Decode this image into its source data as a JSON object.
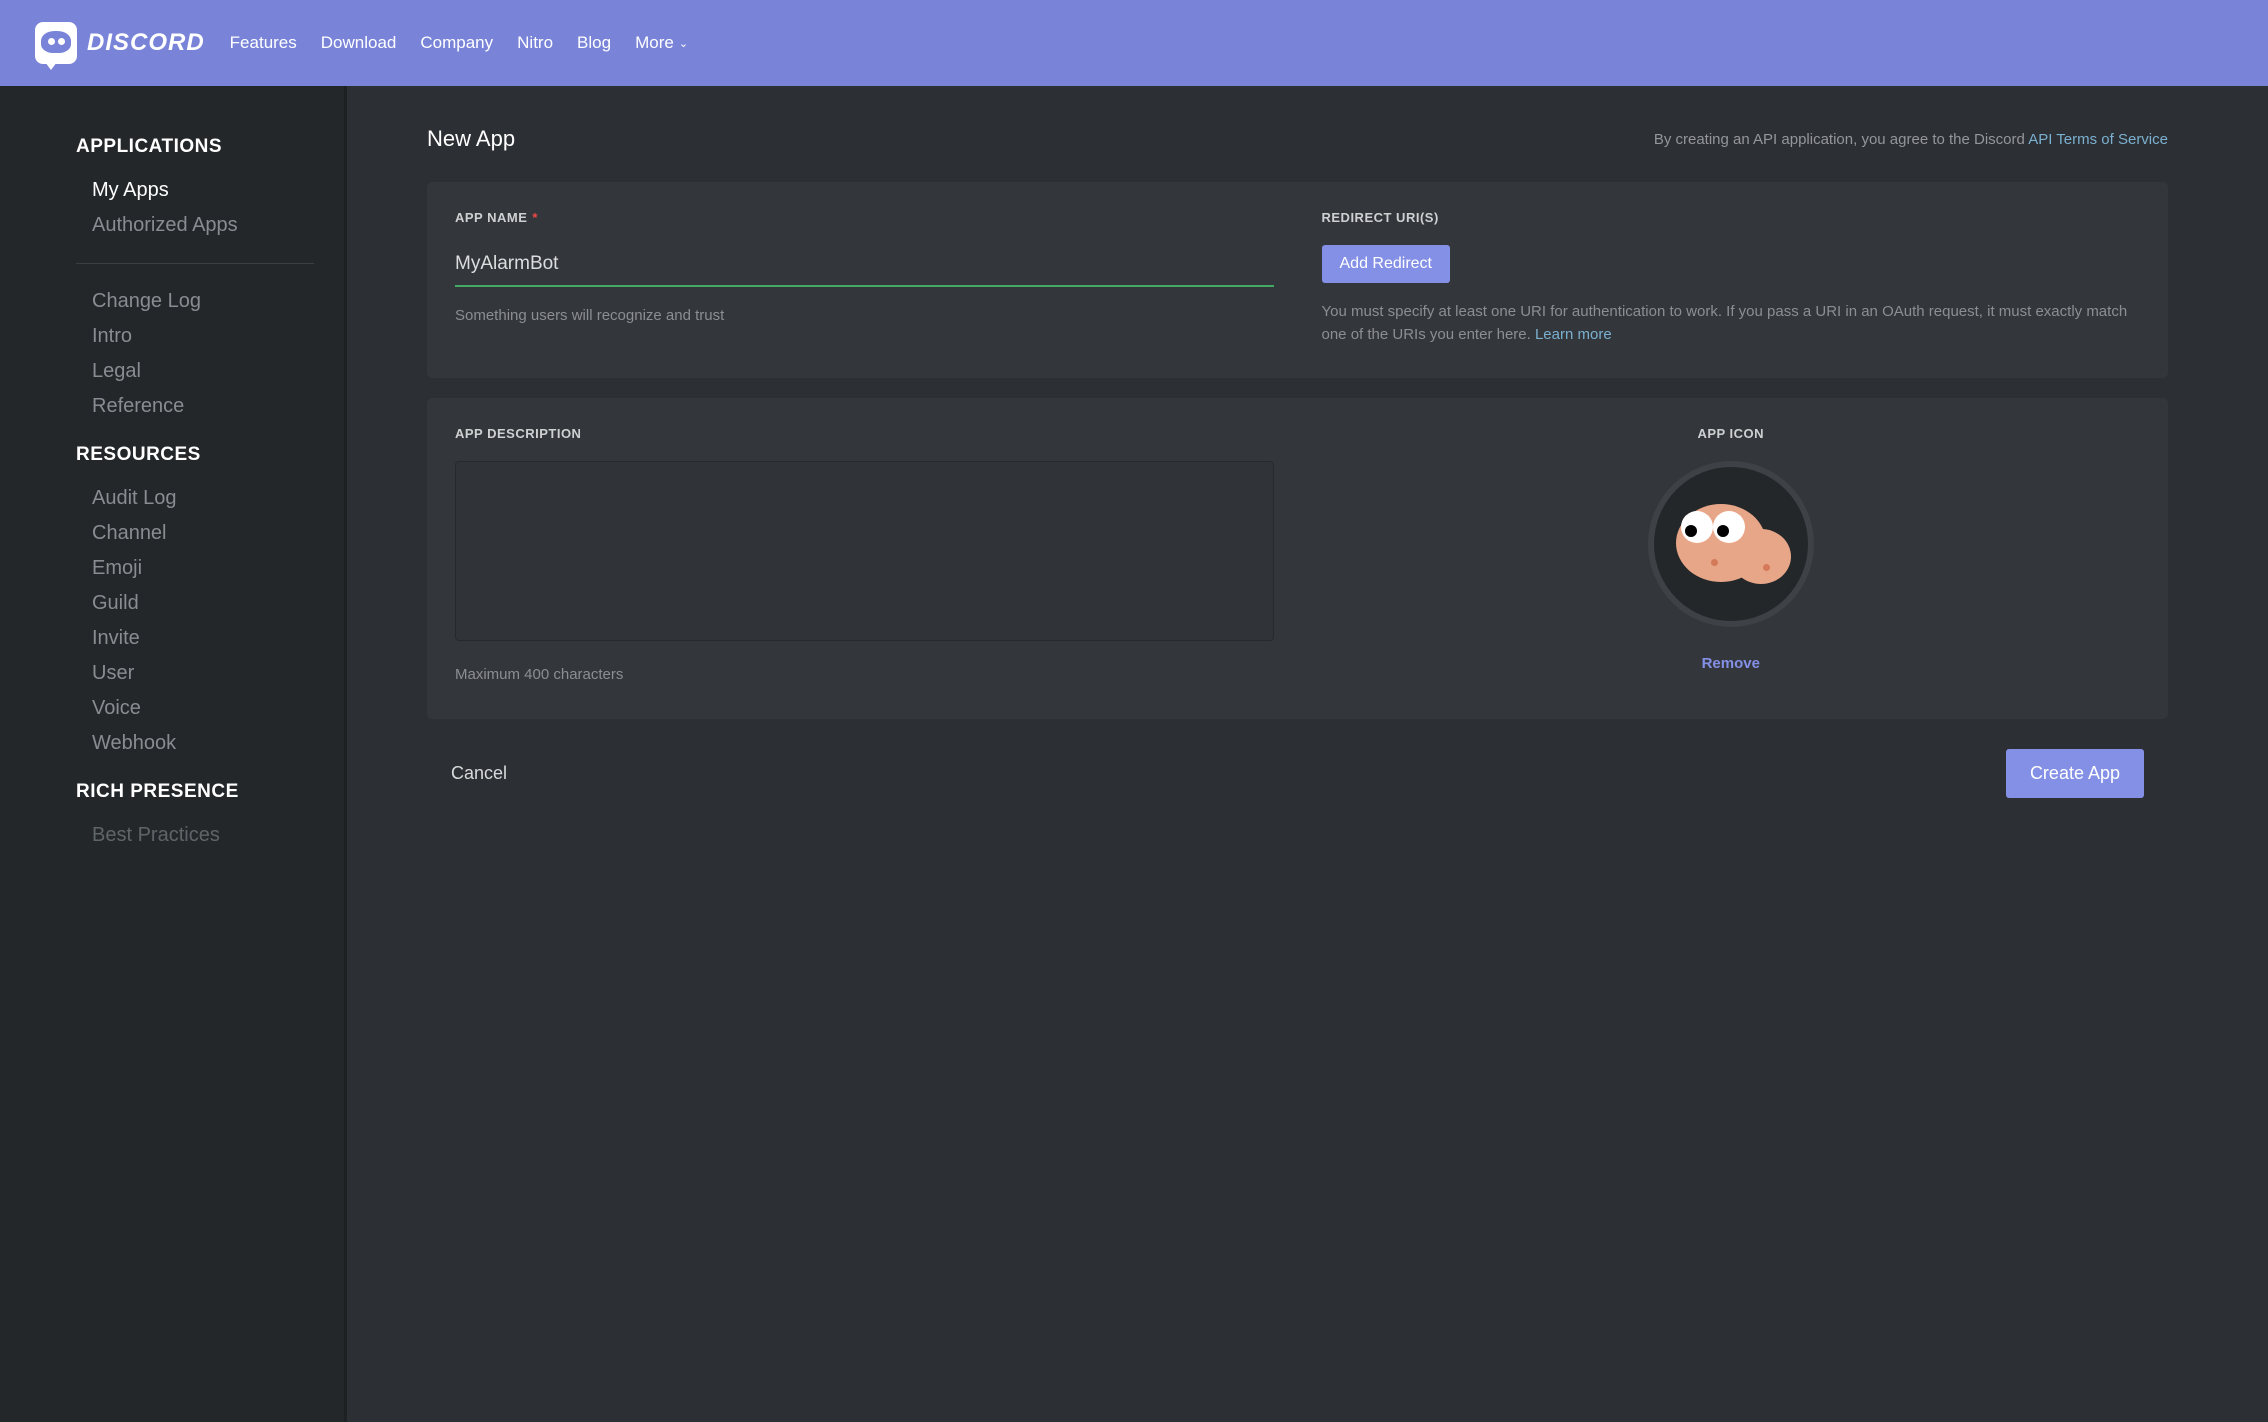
{
  "brand": "DISCORD",
  "nav": {
    "features": "Features",
    "download": "Download",
    "company": "Company",
    "nitro": "Nitro",
    "blog": "Blog",
    "more": "More"
  },
  "sidebar": {
    "applications_heading": "APPLICATIONS",
    "my_apps": "My Apps",
    "authorized_apps": "Authorized Apps",
    "change_log": "Change Log",
    "intro": "Intro",
    "legal": "Legal",
    "reference": "Reference",
    "resources_heading": "RESOURCES",
    "audit_log": "Audit Log",
    "channel": "Channel",
    "emoji": "Emoji",
    "guild": "Guild",
    "invite": "Invite",
    "user": "User",
    "voice": "Voice",
    "webhook": "Webhook",
    "rich_presence_heading": "RICH PRESENCE",
    "best_practices": "Best Practices"
  },
  "page": {
    "title": "New App",
    "tos_prefix": "By creating an API application, you agree to the Discord ",
    "tos_link": "API Terms of Service"
  },
  "form": {
    "app_name_label": "APP NAME",
    "app_name_value": "MyAlarmBot",
    "app_name_helper": "Something users will recognize and trust",
    "redirect_label": "REDIRECT URI(S)",
    "add_redirect_btn": "Add Redirect",
    "redirect_helper_1": "You must specify at least one URI for authentication to work. If you pass a URI in an OAuth request, it must exactly match one of the URIs you enter here. ",
    "redirect_learn_more": "Learn more",
    "description_label": "APP DESCRIPTION",
    "description_helper": "Maximum 400 characters",
    "icon_label": "APP ICON",
    "remove_link": "Remove"
  },
  "actions": {
    "cancel": "Cancel",
    "create": "Create App"
  }
}
